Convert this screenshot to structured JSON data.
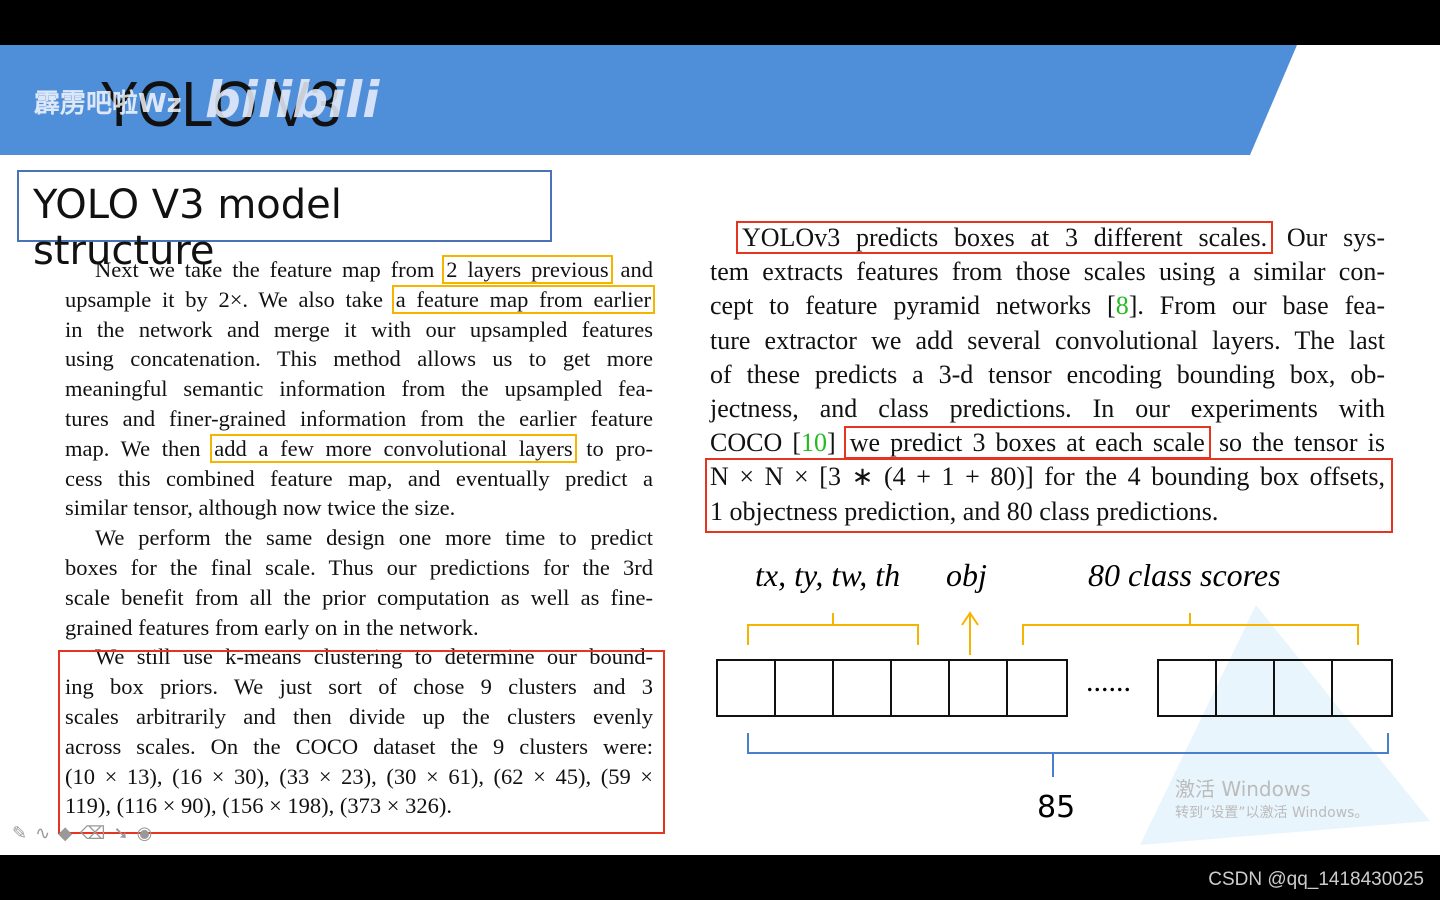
{
  "header": {
    "title": "YOLO V3",
    "watermark": "霹雳吧啦Wz",
    "logo": "bilibili"
  },
  "slide_title": "YOLO V3 model structure",
  "left_lines": [
    [
      {
        "t": "Next we take the feature map from "
      },
      {
        "t": "2 layers previous",
        "hl": "y"
      },
      {
        "t": " and"
      }
    ],
    [
      {
        "t": "upsample it by 2×.  We also take "
      },
      {
        "t": "a feature map from earlier",
        "hl": "y"
      }
    ],
    [
      {
        "t": "in the network and merge it with our upsampled features"
      }
    ],
    [
      {
        "t": "using concatenation.  This method allows us to get more"
      }
    ],
    [
      {
        "t": "meaningful semantic information from the upsampled fea-"
      }
    ],
    [
      {
        "t": "tures and finer-grained information from the earlier feature"
      }
    ],
    [
      {
        "t": "map.  We then "
      },
      {
        "t": "add a few more convolutional layers",
        "hl": "y"
      },
      {
        "t": " to pro-"
      }
    ],
    [
      {
        "t": "cess this combined feature map, and eventually predict a"
      }
    ],
    [
      {
        "t": "similar tensor, although now twice the size."
      }
    ],
    [
      {
        "t": "We perform the same design one more time to predict"
      }
    ],
    [
      {
        "t": "boxes for the final scale.  Thus our predictions for the 3rd"
      }
    ],
    [
      {
        "t": "scale benefit from all the prior computation as well as fine-"
      }
    ],
    [
      {
        "t": "grained features from early on in the network."
      }
    ],
    [
      {
        "t": "We still use k-means clustering to determine our bound-"
      }
    ],
    [
      {
        "t": "ing box priors.   We just sort of chose 9 clusters and 3"
      }
    ],
    [
      {
        "t": "scales arbitrarily and then divide up the clusters evenly"
      }
    ],
    [
      {
        "t": "across scales.  On the COCO dataset the 9 clusters were:"
      }
    ],
    [
      {
        "t": "(10 × 13), (16 × 30), (33 × 23), (30 × 61), (62 × 45), (59 ×"
      }
    ],
    [
      {
        "t": "119), (116 × 90), (156 × 198), (373 × 326)."
      }
    ]
  ],
  "right_lines": [
    [
      {
        "t": "YOLOv3 predicts boxes at 3 different scales.",
        "hl": "r"
      },
      {
        "t": " Our sys-"
      }
    ],
    [
      {
        "t": "tem extracts features from those scales using a similar con-"
      }
    ],
    [
      {
        "t": "cept to feature pyramid networks ["
      },
      {
        "t": "8",
        "hl": "g"
      },
      {
        "t": "].  From our base fea-"
      }
    ],
    [
      {
        "t": "ture extractor we add several convolutional layers.  The last"
      }
    ],
    [
      {
        "t": "of these predicts a 3-d tensor encoding bounding box, ob-"
      }
    ],
    [
      {
        "t": "jectness, and class predictions.   In our experiments with"
      }
    ],
    [
      {
        "t": "COCO ["
      },
      {
        "t": "10",
        "hl": "g"
      },
      {
        "t": "] "
      },
      {
        "t": "we predict 3 boxes at each scale",
        "hl": "r"
      },
      {
        "t": " so the tensor is"
      }
    ],
    [
      {
        "t": "N × N × [3 ∗ (4 + 1 + 80)] for the 4 bounding box offsets,"
      }
    ],
    [
      {
        "t": "1 objectness prediction, and 80 class predictions."
      }
    ]
  ],
  "diagram": {
    "label_coords": "tx, ty, tw, th",
    "label_obj": "obj",
    "label_classes": "80 class scores",
    "ellipsis": "......",
    "total": "85"
  },
  "overlay": {
    "activate_title": "激活 Windows",
    "activate_sub": "转到“设置”以激活 Windows。",
    "toolbar_icons": [
      "pen-icon",
      "curve-icon",
      "fill-icon",
      "eraser-icon",
      "pointer-icon",
      "record-icon"
    ]
  },
  "credit": "CSDN @qq_1418430025",
  "colors": {
    "header": "#4f8ed9",
    "highlight_yellow": "#f5b400",
    "highlight_red": "#e53520",
    "citation": "#22bb22"
  }
}
